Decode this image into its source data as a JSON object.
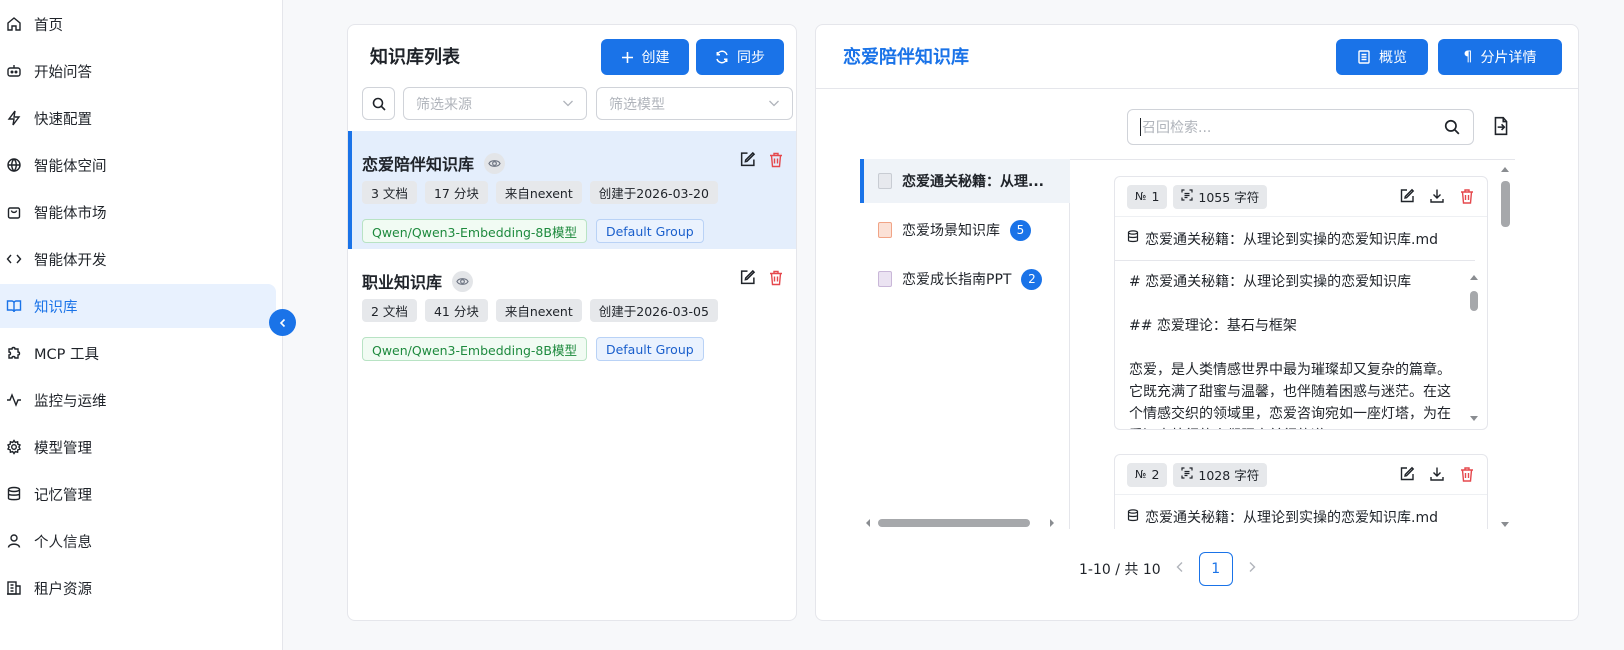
{
  "sidebar": {
    "items": [
      {
        "label": "首页",
        "icon": "home-icon"
      },
      {
        "label": "开始问答",
        "icon": "bot-icon"
      },
      {
        "label": "快速配置",
        "icon": "bolt-icon"
      },
      {
        "label": "智能体空间",
        "icon": "globe-icon"
      },
      {
        "label": "智能体市场",
        "icon": "bag-icon"
      },
      {
        "label": "智能体开发",
        "icon": "code-icon"
      },
      {
        "label": "知识库",
        "icon": "book-icon"
      },
      {
        "label": "MCP 工具",
        "icon": "puzzle-icon"
      },
      {
        "label": "监控与运维",
        "icon": "activity-icon"
      },
      {
        "label": "模型管理",
        "icon": "gear-icon"
      },
      {
        "label": "记忆管理",
        "icon": "database-icon"
      },
      {
        "label": "个人信息",
        "icon": "user-icon"
      },
      {
        "label": "租户资源",
        "icon": "building-icon"
      }
    ],
    "active_index": 6
  },
  "kb_list": {
    "title": "知识库列表",
    "create_label": "创建",
    "sync_label": "同步",
    "filter_source_placeholder": "筛选来源",
    "filter_model_placeholder": "筛选模型",
    "items": [
      {
        "name": "恋爱陪伴知识库",
        "docs": "3 文档",
        "chunks": "17 分块",
        "source": "来自nexent",
        "created": "创建于2026-03-20",
        "model": "Qwen/Qwen3-Embedding-8B模型",
        "group": "Default Group"
      },
      {
        "name": "职业知识库",
        "docs": "2 文档",
        "chunks": "41 分块",
        "source": "来自nexent",
        "created": "创建于2026-03-05",
        "model": "Qwen/Qwen3-Embedding-8B模型",
        "group": "Default Group"
      }
    ]
  },
  "detail": {
    "title": "恋爱陪伴知识库",
    "overview_label": "概览",
    "chunk_detail_label": "分片详情",
    "search_placeholder": "召回检索...",
    "documents": [
      {
        "name": "恋爱通关秘籍：从理...",
        "badge": ""
      },
      {
        "name": "恋爱场景知识库",
        "badge": "5"
      },
      {
        "name": "恋爱成长指南PPT",
        "badge": "2"
      }
    ],
    "chunks": [
      {
        "no": "1",
        "chars": "1055 字符",
        "file": "恋爱通关秘籍：从理论到实操的恋爱知识库.md",
        "lines": [
          "# 恋爱通关秘籍：从理论到实操的恋爱知识库",
          "## 恋爱理论：基石与框架",
          "恋爱，是人类情感世界中最为璀璨却又复杂的篇章。它既充满了甜蜜与温馨，也伴随着困惑与迷茫。在这个情感交织的领域里，恋爱咨询宛如一座灯塔，为在爱河中航行的人们照亮前行的道"
        ]
      },
      {
        "no": "2",
        "chars": "1028 字符",
        "file": "恋爱通关秘籍：从理论到实操的恋爱知识库.md",
        "lines": []
      }
    ],
    "pagination": {
      "summary": "1-10 / 共 10",
      "current": "1"
    }
  },
  "colors": {
    "primary": "#1a73e8",
    "danger": "#e5484d",
    "active_bg": "#e4eefc"
  }
}
